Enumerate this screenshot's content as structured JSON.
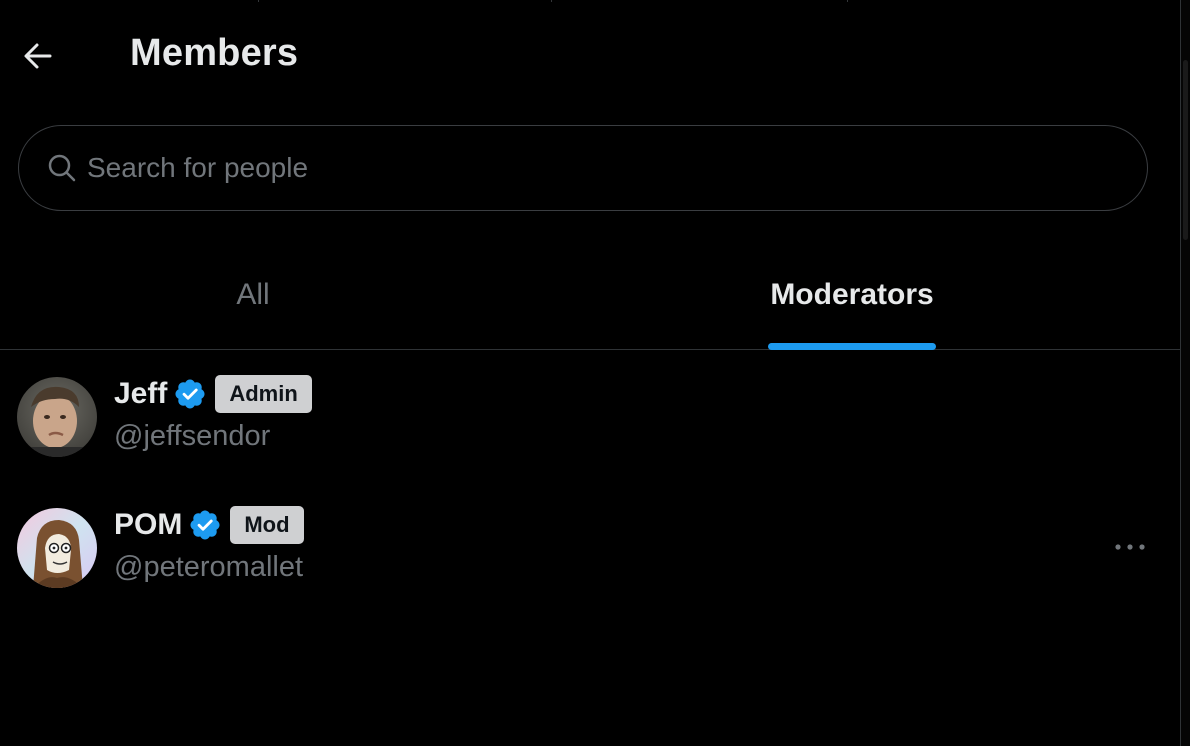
{
  "header": {
    "title": "Members",
    "back_icon": "arrow-left-icon"
  },
  "search": {
    "placeholder": "Search for people",
    "value": "",
    "icon": "search-icon"
  },
  "tabs": [
    {
      "label": "All",
      "active": false
    },
    {
      "label": "Moderators",
      "active": true
    }
  ],
  "members": [
    {
      "name": "Jeff",
      "handle": "@jeffsendor",
      "verified": true,
      "role": "Admin"
    },
    {
      "name": "POM",
      "handle": "@peteromallet",
      "verified": true,
      "role": "Mod"
    }
  ],
  "colors": {
    "background": "#000000",
    "accent": "#1d9bf0",
    "text_primary": "#e7e9ea",
    "text_secondary": "#71767b",
    "border": "#2f3336",
    "badge_bg": "#cfd0d2"
  }
}
